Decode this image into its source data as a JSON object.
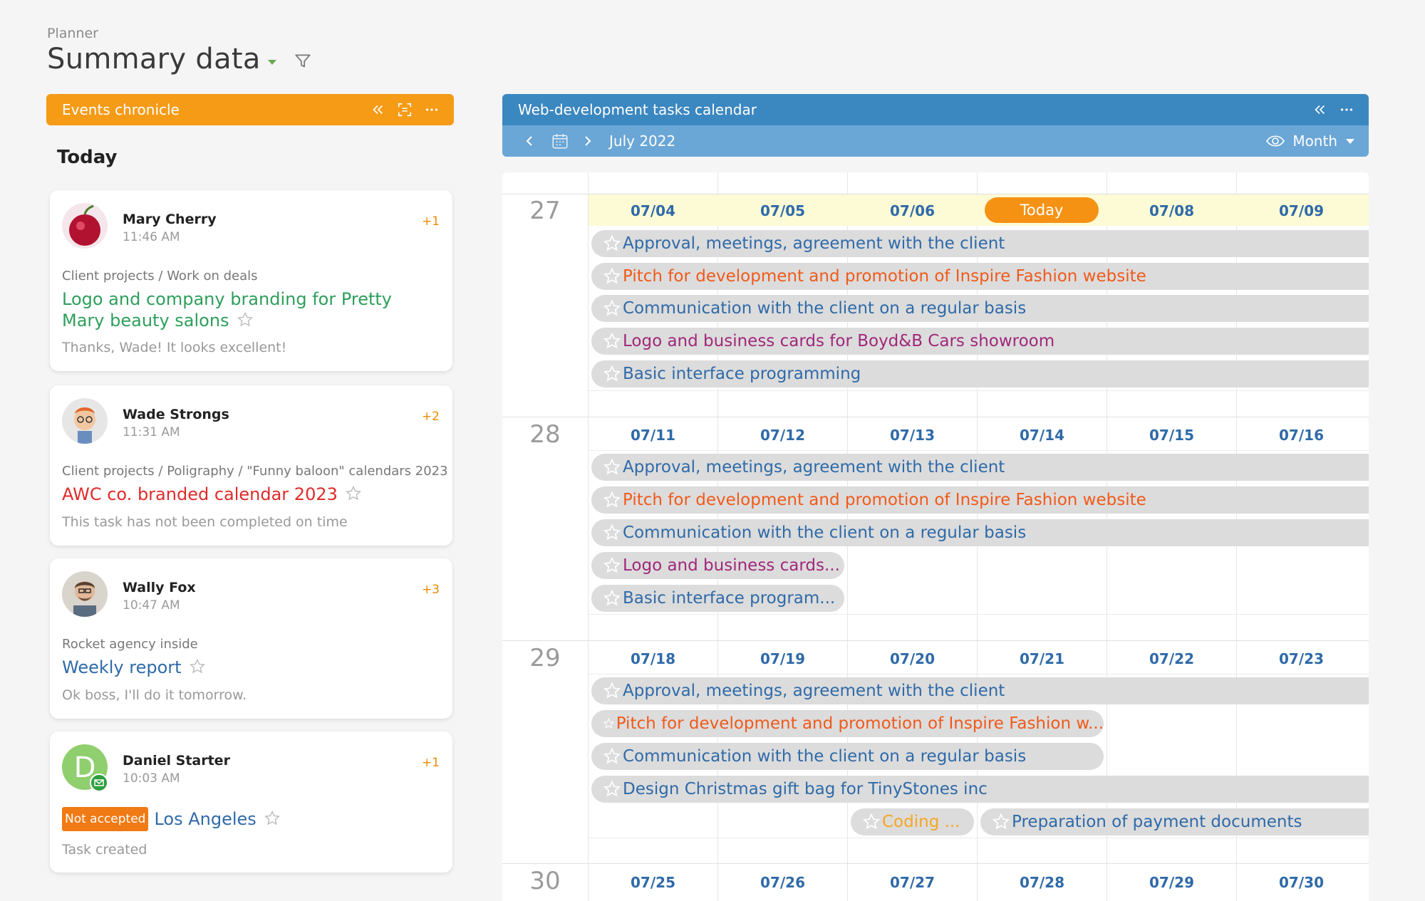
{
  "header": {
    "breadcrumb": "Planner",
    "title": "Summary data"
  },
  "left_panel": {
    "title": "Events chronicle",
    "section": "Today",
    "cards": [
      {
        "name": "Mary Cherry",
        "time": "11:46 AM",
        "count": "+1",
        "path": "Client projects / Work on deals",
        "task_line1": "Logo and company branding for Pretty",
        "task_line2": "Mary beauty salons",
        "task_color": "#2e9e5b",
        "comment": "Thanks, Wade! It looks excellent!"
      },
      {
        "name": "Wade Strongs",
        "time": "11:31 AM",
        "count": "+2",
        "path": "Client projects / Poligraphy / \"Funny baloon\" calendars 2023",
        "task_line1": "AWC co. branded calendar 2023",
        "task_color": "#e02b2b",
        "comment": "This task has not been completed on time"
      },
      {
        "name": "Wally Fox",
        "time": "10:47 AM",
        "count": "+3",
        "path": "Rocket agency inside",
        "task_line1": "Weekly report",
        "task_color": "#2f6aa8",
        "comment": "Ok boss, I'll do it tomorrow."
      },
      {
        "name": "Daniel Starter",
        "time": "10:03 AM",
        "count": "+1",
        "badge": "Not accepted",
        "task_line1": "Los Angeles",
        "task_color": "#2f6aa8",
        "comment": "Task created",
        "avatar_letter": "D"
      }
    ]
  },
  "calendar": {
    "title": "Web-development tasks calendar",
    "month_label": "July 2022",
    "view_label": "Month",
    "today_label": "Today",
    "weeks": [
      {
        "num": "27",
        "days": [
          "07/04",
          "07/05",
          "07/06",
          "Today",
          "07/08",
          "07/09"
        ]
      },
      {
        "num": "28",
        "days": [
          "07/11",
          "07/12",
          "07/13",
          "07/14",
          "07/15",
          "07/16"
        ]
      },
      {
        "num": "29",
        "days": [
          "07/18",
          "07/19",
          "07/20",
          "07/21",
          "07/22",
          "07/23"
        ]
      },
      {
        "num": "30",
        "days": [
          "07/25",
          "07/26",
          "07/27",
          "07/28",
          "07/29",
          "07/30"
        ]
      }
    ],
    "events": {
      "w27": [
        {
          "label": "Approval, meetings, agreement with the client",
          "color": "#2f6aa8"
        },
        {
          "label": "Pitch for development and promotion of Inspire Fashion website",
          "color": "#f05a1a"
        },
        {
          "label": "Communication with the client on a regular basis",
          "color": "#2f6aa8"
        },
        {
          "label": "Logo and business cards for Boyd&B Cars showroom",
          "color": "#a0287a"
        },
        {
          "label": "Basic interface programming",
          "color": "#2f6aa8"
        }
      ],
      "w28": [
        {
          "label": "Approval, meetings, agreement with the client",
          "color": "#2f6aa8"
        },
        {
          "label": "Pitch for development and promotion of Inspire Fashion website",
          "color": "#f05a1a"
        },
        {
          "label": "Communication with the client on a regular basis",
          "color": "#2f6aa8"
        },
        {
          "label": "Logo and business cards...",
          "color": "#a0287a"
        },
        {
          "label": "Basic interface program...",
          "color": "#2f6aa8"
        }
      ],
      "w29": [
        {
          "label": "Approval, meetings, agreement with the client",
          "color": "#2f6aa8"
        },
        {
          "label": "Pitch for development and promotion of Inspire Fashion w...",
          "color": "#f05a1a"
        },
        {
          "label": "Communication with the client on a regular basis",
          "color": "#2f6aa8"
        },
        {
          "label": "Design Christmas gift bag for TinyStones inc",
          "color": "#2f6aa8"
        },
        {
          "label": "Coding ...",
          "color": "#f5a623"
        },
        {
          "label": "Preparation of payment documents",
          "color": "#2f6aa8"
        }
      ]
    }
  }
}
